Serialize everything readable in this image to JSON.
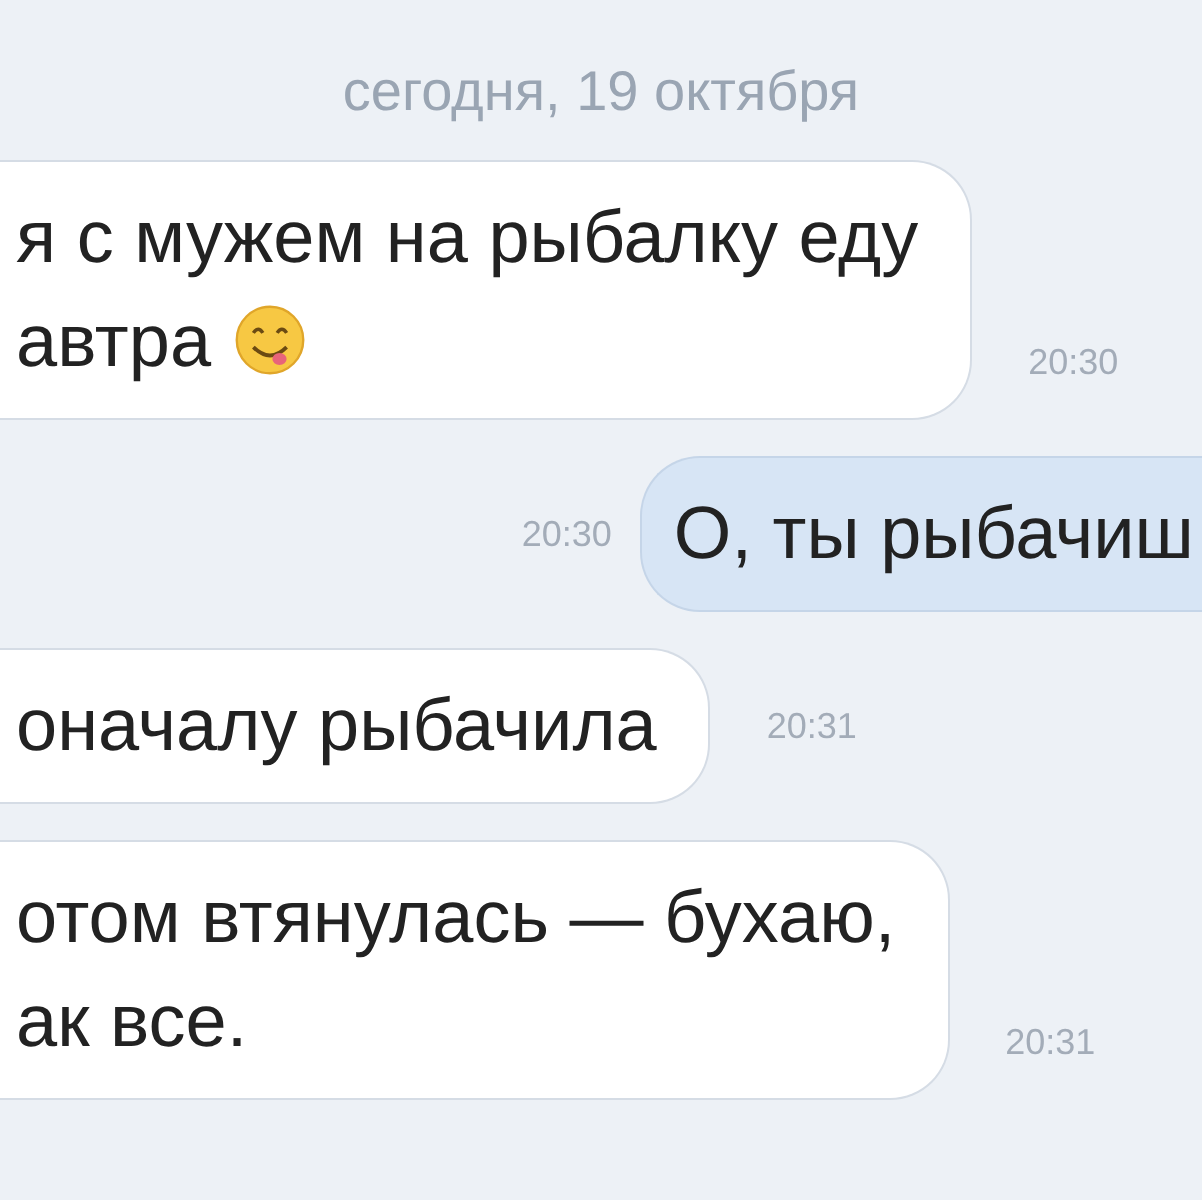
{
  "date_header": "сегодня, 19 октября",
  "messages": [
    {
      "kind": "incoming",
      "lines": [
        "я с мужем на рыбалку еду",
        "автра"
      ],
      "emoji": true,
      "time": "20:30"
    },
    {
      "kind": "outgoing",
      "lines": [
        "О, ты рыбачиш"
      ],
      "emoji": false,
      "time": "20:30"
    },
    {
      "kind": "incoming",
      "lines": [
        "оначалу рыбачила"
      ],
      "emoji": false,
      "time": "20:31"
    },
    {
      "kind": "incoming",
      "lines": [
        "отом втянулась — бухаю,",
        "ак все."
      ],
      "emoji": false,
      "time": "20:31"
    }
  ]
}
